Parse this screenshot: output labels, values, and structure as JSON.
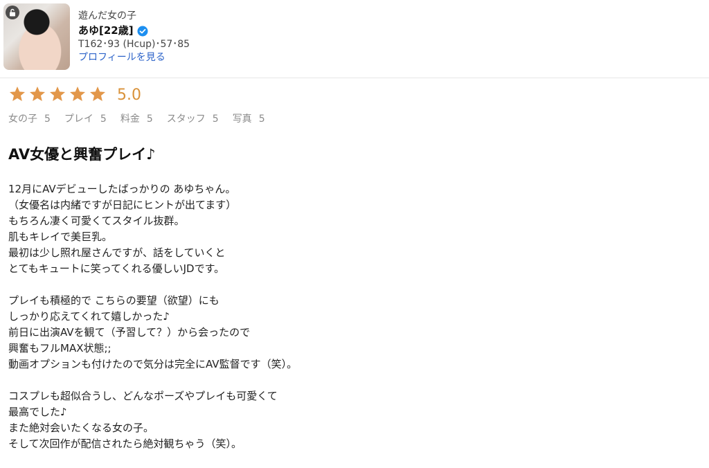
{
  "cast": {
    "shop_label": "遊んだ女の子",
    "name": "あゆ[22歳]",
    "stats": "T162･93 (Hcup)･57･85",
    "profile_link": "プロフィールを見る"
  },
  "rating": {
    "stars": 5,
    "score": "5.0",
    "star_color": "#e2974a",
    "subratings": [
      {
        "label": "女の子",
        "value": "5"
      },
      {
        "label": "プレイ",
        "value": "5"
      },
      {
        "label": "料金",
        "value": "5"
      },
      {
        "label": "スタッフ",
        "value": "5"
      },
      {
        "label": "写真",
        "value": "5"
      }
    ]
  },
  "review": {
    "title": "AV女優と興奮プレイ♪",
    "paragraphs": [
      [
        "12月にAVデビューしたばっかりの あゆちゃん。",
        "（女優名は内緒ですが日記にヒントが出てます）",
        "もちろん凄く可愛くてスタイル抜群。",
        "肌もキレイで美巨乳。",
        "最初は少し照れ屋さんですが、話をしていくと",
        "とてもキュートに笑ってくれる優しいJDです。"
      ],
      [
        "プレイも積極的で こちらの要望（欲望）にも",
        "しっかり応えてくれて嬉しかった♪",
        "前日に出演AVを観て（予習して？）から会ったので",
        "興奮もフルMAX状態;;",
        "動画オプションも付けたので気分は完全にAV監督です（笑）。"
      ],
      [
        "コスプレも超似合うし、どんなポーズやプレイも可愛くて",
        "最高でした♪",
        "また絶対会いたくなる女の子。",
        "そして次回作が配信されたら絶対観ちゃう（笑）。"
      ]
    ]
  },
  "colors": {
    "link": "#2c63c9",
    "verified": "#1d8ff0",
    "score": "#d9923a"
  }
}
